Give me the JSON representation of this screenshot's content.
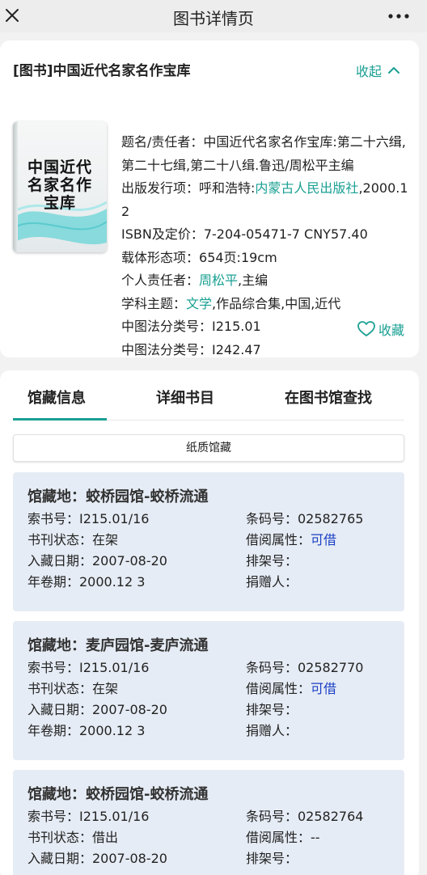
{
  "header": {
    "title": "图书详情页"
  },
  "book": {
    "title": "[图书]中国近代名家名作宝库",
    "collapse_label": "收起",
    "cover_text": "中国近代名家名作宝库",
    "fields": {
      "title_resp_label": "题名/责任者：",
      "title_resp_value": "中国近代名家名作宝库:第二十六缉,第二十七缉,第二十八缉.鲁迅/周松平主编",
      "publish_label": "出版发行项：",
      "publish_place": "呼和浩特:",
      "publisher": "内蒙古人民出版社",
      "publish_date": ",2000.12",
      "isbn_label": "ISBN及定价：",
      "isbn_value": "7-204-05471-7 CNY57.40",
      "carrier_label": "载体形态项：",
      "carrier_value": "654页:19cm",
      "person_label": "个人责任者：",
      "person_name": "周松平",
      "person_role": ",主编",
      "subject_label": "学科主题：",
      "subject_link": "文学",
      "subject_rest": ",作品综合集,中国,近代",
      "clc1_label": "中图法分类号：",
      "clc1_value": "I215.01",
      "clc2_label": "中图法分类号：",
      "clc2_value": "I242.47"
    },
    "favorite_label": "收藏"
  },
  "tabs": [
    "馆藏信息",
    "详细书目",
    "在图书馆查找"
  ],
  "paper_button": "纸质馆藏",
  "copies": [
    {
      "location": "馆藏地：蛟桥园馆-蛟桥流通",
      "call_no": "索书号：I215.01/16",
      "status": "书刊状态：在架",
      "date": "入藏日期：2007-08-20",
      "volume": "年卷期：2000.12 3",
      "barcode": "条码号：02582765",
      "loan_label": "借阅属性：",
      "loan_value": "可借",
      "shelf": "排架号：",
      "donor": "捐赠人："
    },
    {
      "location": "馆藏地：麦庐园馆-麦庐流通",
      "call_no": "索书号：I215.01/16",
      "status": "书刊状态：在架",
      "date": "入藏日期：2007-08-20",
      "volume": "年卷期：2000.12 3",
      "barcode": "条码号：02582770",
      "loan_label": "借阅属性：",
      "loan_value": "可借",
      "shelf": "排架号：",
      "donor": "捐赠人："
    },
    {
      "location": "馆藏地：蛟桥园馆-蛟桥流通",
      "call_no": "索书号：I215.01/16",
      "status": "书刊状态：借出",
      "date": "入藏日期：2007-08-20",
      "volume": "",
      "barcode": "条码号：02582764",
      "loan_label": "借阅属性：",
      "loan_value": "--",
      "shelf": "排架号：",
      "donor": ""
    }
  ],
  "colors": {
    "accent": "#1aa093",
    "available": "#1a3fc4",
    "copy_bg": "#e6ecf5"
  }
}
